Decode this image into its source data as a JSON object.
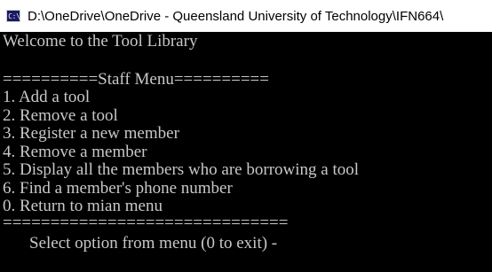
{
  "window": {
    "title": "D:\\OneDrive\\OneDrive - Queensland University of Technology\\IFN664\\",
    "icon": "console-icon"
  },
  "console": {
    "welcome": "Welcome to the Tool Library",
    "menu_header": "==========Staff Menu==========",
    "menu_items": [
      "1. Add a tool",
      "2. Remove a tool",
      "3. Register a new member",
      "4. Remove a member",
      "5. Display all the members who are borrowing a tool",
      "6. Find a member's phone number",
      "0. Return to mian menu"
    ],
    "menu_footer": "==============================",
    "prompt": "Select option from menu (0 to exit) -"
  },
  "colors": {
    "console_background": "#000000",
    "console_text": "#c8c8c8",
    "titlebar_background": "#ffffff",
    "icon_background": "#1a1a66"
  }
}
